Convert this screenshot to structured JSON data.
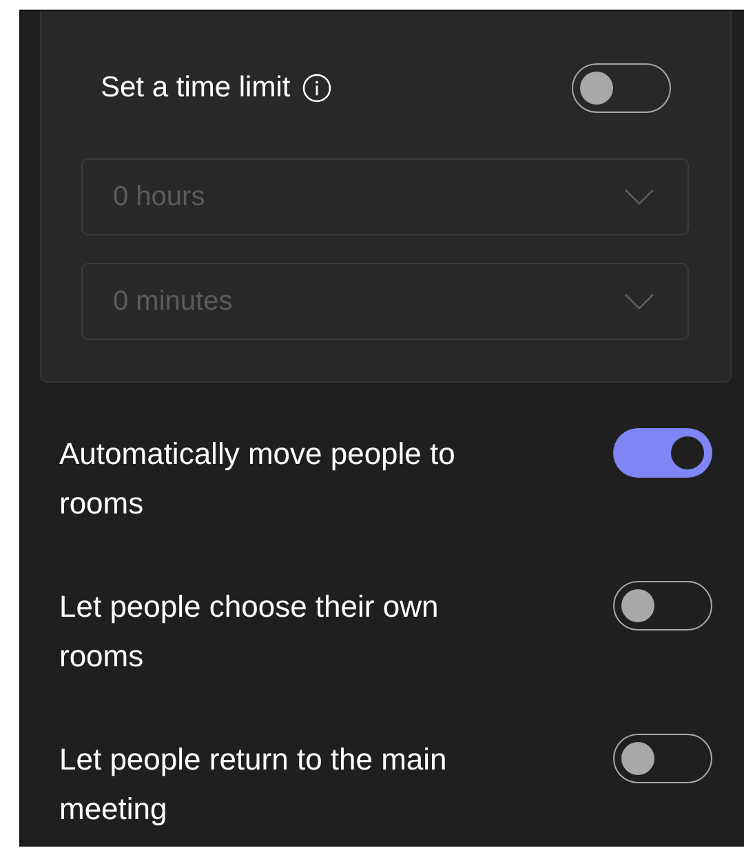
{
  "time_limit": {
    "label": "Set a time limit",
    "on": false,
    "dropdowns": [
      {
        "value": "0 hours",
        "disabled": true
      },
      {
        "value": "0 minutes",
        "disabled": true
      }
    ]
  },
  "options": [
    {
      "label": "Automatically move people to rooms",
      "on": true
    },
    {
      "label": "Let people choose their own rooms",
      "on": false
    },
    {
      "label": "Let people return to the main meeting",
      "on": false
    }
  ]
}
